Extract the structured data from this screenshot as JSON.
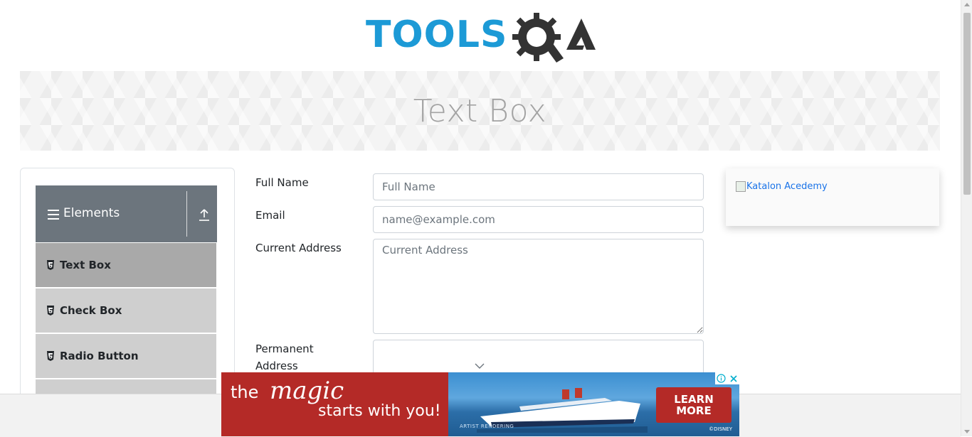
{
  "header": {
    "logo_text": "TOOLSQA",
    "colors": {
      "logo_blue": "#1c9ad6",
      "logo_dark": "#333333"
    }
  },
  "banner": {
    "title": "Text Box"
  },
  "sidebar": {
    "group_title": "Elements",
    "group_icon": "hamburger-icon",
    "collapse_icon": "upload-arrow-icon",
    "items": [
      {
        "label": "Text Box",
        "icon": "html5-icon",
        "active": true
      },
      {
        "label": "Check Box",
        "icon": "html5-icon",
        "active": false
      },
      {
        "label": "Radio Button",
        "icon": "html5-icon",
        "active": false
      }
    ]
  },
  "form": {
    "full_name": {
      "label": "Full Name",
      "placeholder": "Full Name",
      "value": ""
    },
    "email": {
      "label": "Email",
      "placeholder": "name@example.com",
      "value": ""
    },
    "current_address": {
      "label": "Current Address",
      "placeholder": "Current Address",
      "value": ""
    },
    "permanent_address": {
      "label": "Permanent Address",
      "value": ""
    }
  },
  "promo": {
    "image_alt": "Katalon Acedemy"
  },
  "ad": {
    "text_the": "the",
    "text_magic": "magic",
    "text_tagline": "starts with you!",
    "cta_line1": "LEARN",
    "cta_line2": "MORE",
    "disclaimer": "ARTIST RENDERING",
    "brand": "©DISNEY",
    "colors": {
      "ad_red": "#b42a27"
    }
  }
}
